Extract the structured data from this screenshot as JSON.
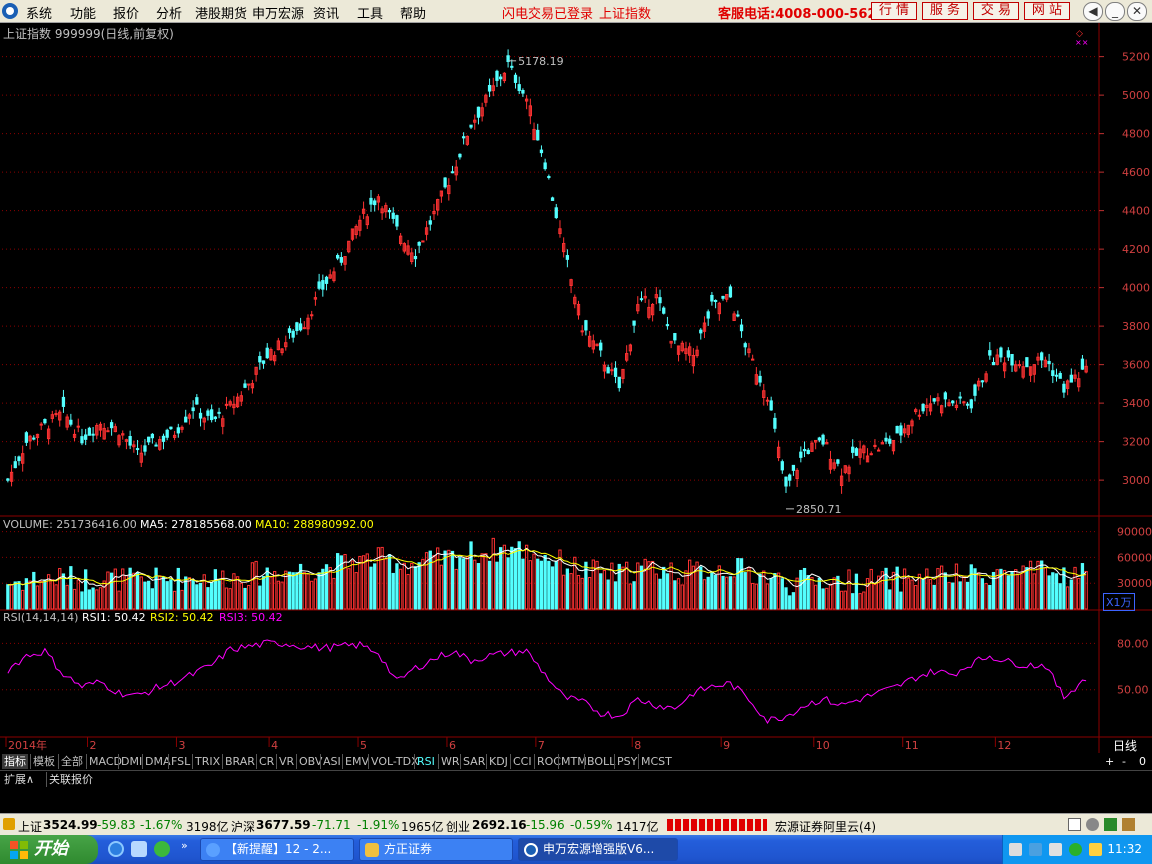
{
  "menubar": {
    "items": [
      "系统",
      "功能",
      "报价",
      "分析",
      "港股期货",
      "申万宏源",
      "资讯",
      "工具",
      "帮助"
    ],
    "notice": "闪电交易已登录",
    "index_link": "上证指数",
    "hotline": "客服电话:4008-000-562",
    "buttons": [
      "行 情",
      "服 务",
      "交 易",
      "网 站"
    ]
  },
  "chart": {
    "title": "上证指数 999999(日线,前复权)",
    "volume_header": {
      "volume": "VOLUME: 251736416.00",
      "ma5": "MA5: 278185568.00",
      "ma10": "MA10: 288980992.00"
    },
    "rsi_header": {
      "name": "RSI(14,14,14)",
      "rsi1": "RSI1: 50.42",
      "rsi2": "RSI2: 50.42",
      "rsi3": "RSI3: 50.42"
    },
    "price_axis": [
      "5200",
      "5000",
      "4800",
      "4600",
      "4400",
      "4200",
      "4000",
      "3800",
      "3600",
      "3400",
      "3200",
      "3000"
    ],
    "volume_axis": [
      "90000",
      "60000",
      "30000"
    ],
    "volume_unit": "X1万",
    "rsi_axis": [
      "80.00",
      "50.00"
    ],
    "high_label": "5178.19",
    "low_label": "2850.71",
    "period": "日线",
    "date_labels": [
      "2014年",
      "2",
      "3",
      "4",
      "5",
      "6",
      "7",
      "8",
      "9",
      "10",
      "11",
      "12"
    ],
    "colors": {
      "up": "#ff3232",
      "down": "#54ffff",
      "ma5": "#ffffff",
      "ma10": "#ffff00",
      "rsi": "#ff00ff",
      "grid": "#8b0000"
    }
  },
  "chart_data": {
    "type": "candlestick",
    "ylim": [
      2850,
      5250
    ],
    "high": 5178.19,
    "low": 2850.71,
    "approx_closes": [
      [
        0,
        3000
      ],
      [
        5,
        3200
      ],
      [
        10,
        3280
      ],
      [
        15,
        3350
      ],
      [
        20,
        3220
      ],
      [
        25,
        3300
      ],
      [
        30,
        3260
      ],
      [
        35,
        3130
      ],
      [
        40,
        3200
      ],
      [
        45,
        3250
      ],
      [
        50,
        3380
      ],
      [
        55,
        3300
      ],
      [
        60,
        3380
      ],
      [
        65,
        3500
      ],
      [
        70,
        3650
      ],
      [
        75,
        3720
      ],
      [
        80,
        3820
      ],
      [
        85,
        4000
      ],
      [
        90,
        4150
      ],
      [
        95,
        4350
      ],
      [
        100,
        4480
      ],
      [
        105,
        4300
      ],
      [
        110,
        4180
      ],
      [
        115,
        4380
      ],
      [
        120,
        4600
      ],
      [
        125,
        4850
      ],
      [
        130,
        5000
      ],
      [
        135,
        5160
      ],
      [
        140,
        4980
      ],
      [
        145,
        4650
      ],
      [
        150,
        4200
      ],
      [
        155,
        3800
      ],
      [
        160,
        3650
      ],
      [
        165,
        3480
      ],
      [
        170,
        3900
      ],
      [
        175,
        3950
      ],
      [
        180,
        3700
      ],
      [
        185,
        3650
      ],
      [
        190,
        3900
      ],
      [
        195,
        3950
      ],
      [
        200,
        3650
      ],
      [
        205,
        3450
      ],
      [
        210,
        2950
      ],
      [
        215,
        3150
      ],
      [
        220,
        3200
      ],
      [
        225,
        3050
      ],
      [
        230,
        3150
      ],
      [
        235,
        3170
      ],
      [
        240,
        3220
      ],
      [
        245,
        3350
      ],
      [
        250,
        3420
      ],
      [
        255,
        3400
      ],
      [
        260,
        3400
      ],
      [
        265,
        3620
      ],
      [
        270,
        3640
      ],
      [
        275,
        3600
      ],
      [
        280,
        3630
      ],
      [
        285,
        3480
      ],
      [
        290,
        3560
      ]
    ],
    "rsi_values": [
      [
        0,
        63
      ],
      [
        5,
        72
      ],
      [
        10,
        75
      ],
      [
        15,
        60
      ],
      [
        20,
        52
      ],
      [
        25,
        55
      ],
      [
        30,
        48
      ],
      [
        35,
        46
      ],
      [
        40,
        51
      ],
      [
        45,
        55
      ],
      [
        50,
        60
      ],
      [
        55,
        66
      ],
      [
        60,
        76
      ],
      [
        65,
        78
      ],
      [
        70,
        80
      ],
      [
        75,
        80
      ],
      [
        80,
        78
      ],
      [
        85,
        77
      ],
      [
        90,
        78
      ],
      [
        95,
        79
      ],
      [
        100,
        74
      ],
      [
        105,
        55
      ],
      [
        110,
        64
      ],
      [
        115,
        70
      ],
      [
        120,
        75
      ],
      [
        125,
        69
      ],
      [
        130,
        72
      ],
      [
        135,
        74
      ],
      [
        140,
        75
      ],
      [
        145,
        60
      ],
      [
        150,
        45
      ],
      [
        155,
        42
      ],
      [
        160,
        35
      ],
      [
        165,
        33
      ],
      [
        170,
        44
      ],
      [
        175,
        40
      ],
      [
        180,
        38
      ],
      [
        185,
        48
      ],
      [
        190,
        52
      ],
      [
        195,
        54
      ],
      [
        200,
        44
      ],
      [
        205,
        30
      ],
      [
        210,
        33
      ],
      [
        215,
        40
      ],
      [
        220,
        44
      ],
      [
        225,
        40
      ],
      [
        230,
        44
      ],
      [
        235,
        48
      ],
      [
        240,
        52
      ],
      [
        245,
        58
      ],
      [
        250,
        62
      ],
      [
        255,
        60
      ],
      [
        260,
        67
      ],
      [
        265,
        72
      ],
      [
        270,
        68
      ],
      [
        275,
        66
      ],
      [
        280,
        66
      ],
      [
        285,
        45
      ],
      [
        290,
        56
      ]
    ]
  },
  "indicator_tabs": [
    "指标",
    "模板",
    "全部",
    "MACD",
    "DMI",
    "DMA",
    "FSL",
    "TRIX",
    "BRAR",
    "CR",
    "VR",
    "OBV",
    "ASI",
    "EMV",
    "VOL-TDX",
    "RSI",
    "WR",
    "SAR",
    "KDJ",
    "CCI",
    "ROC",
    "MTM",
    "BOLL",
    "PSY",
    "MCST"
  ],
  "active_tab": "RSI",
  "scroll_controls": [
    "+",
    "-",
    "0"
  ],
  "sub_tabs": [
    "扩展",
    "关联报价"
  ],
  "statusbar": {
    "sh_label": "上证",
    "sh_val": "3524.99",
    "sh_chg": "-59.83",
    "sh_pct": "-1.67%",
    "sh_amt": "3198亿",
    "hs_label": "沪深",
    "hs_val": "3677.59",
    "hs_chg": "-71.71",
    "hs_pct": "-1.91%",
    "hs_amt": "1965亿",
    "cy_label": "创业",
    "cy_val": "2692.16",
    "cy_chg": "-15.96",
    "cy_pct": "-0.59%",
    "cy_amt": "1417亿",
    "server": "宏源证券阿里云(4)"
  },
  "taskbar": {
    "start": "开始",
    "tasks": [
      "【新提醒】12 - 2...",
      "方正证券",
      "申万宏源增强版V6..."
    ],
    "clock": "11:32"
  }
}
